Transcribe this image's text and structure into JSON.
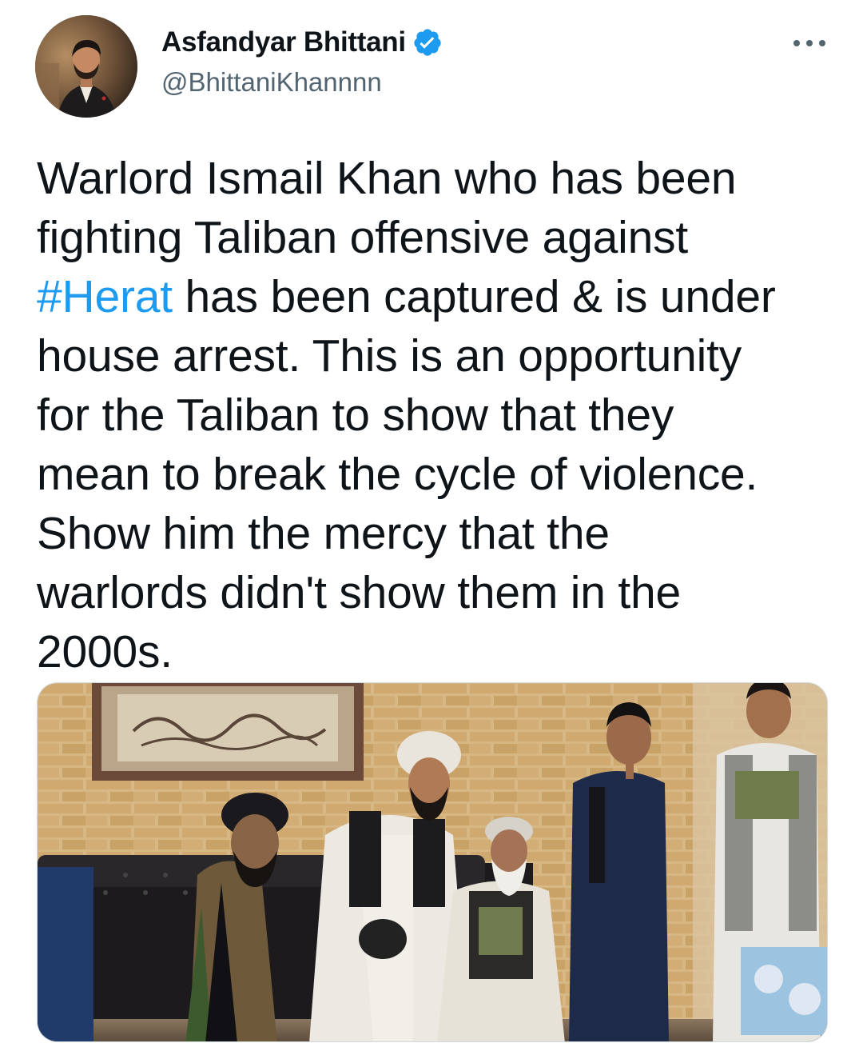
{
  "author": {
    "display_name": "Asfandyar Bhittani",
    "handle": "@BhittaniKhannnn",
    "verified": true
  },
  "tweet": {
    "lines": [
      {
        "text": "Warlord Ismail Khan who has been"
      },
      {
        "text": "fighting Taliban offensive against"
      },
      {
        "hashtag": "#Herat",
        "text": " has been captured & is under"
      },
      {
        "text": "house arrest. This is an opportunity"
      },
      {
        "text": "for the Taliban to show that they"
      },
      {
        "text": "mean to break the cycle of violence."
      },
      {
        "text": "Show him the mercy that the"
      },
      {
        "text": "warlords didn't show them in the"
      },
      {
        "text": "2000s."
      }
    ]
  },
  "icons": {
    "verified": "verified-badge-icon",
    "more": "more-options-icon"
  },
  "colors": {
    "link": "#1d9bf0",
    "text": "#0f1419",
    "secondary": "#536471",
    "verified": "#1d9bf0"
  }
}
